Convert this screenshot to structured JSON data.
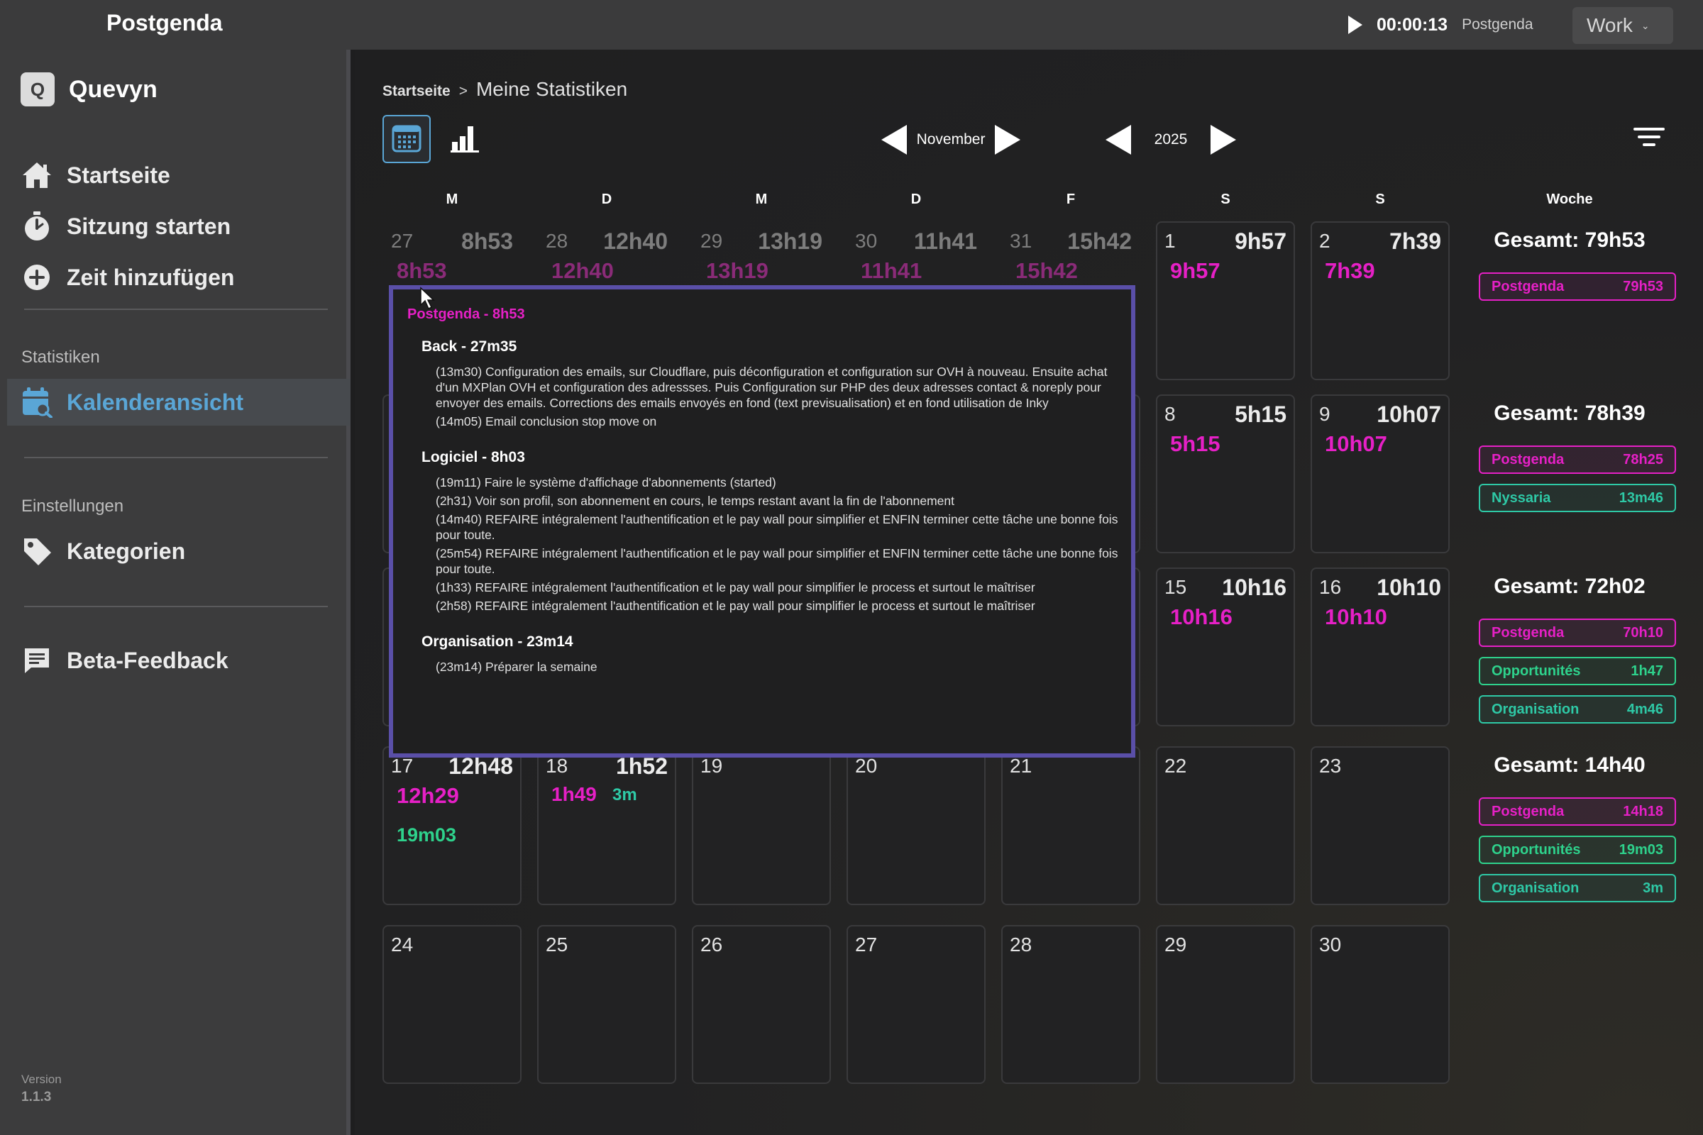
{
  "app": {
    "title": "Postgenda"
  },
  "timer": {
    "value": "00:00:13",
    "project": "Postgenda"
  },
  "workspace": {
    "label": "Work"
  },
  "sidebar": {
    "brand": {
      "logo_letter": "Q",
      "name": "Quevyn"
    },
    "nav": [
      {
        "label": "Startseite",
        "icon": "home-icon"
      },
      {
        "label": "Sitzung starten",
        "icon": "stopwatch-icon"
      },
      {
        "label": "Zeit hinzufügen",
        "icon": "plus-circle-icon"
      }
    ],
    "section_statistics": "Statistiken",
    "calendar_view": {
      "label": "Kalenderansicht",
      "icon": "calendar-search-icon"
    },
    "section_settings": "Einstellungen",
    "categories": {
      "label": "Kategorien",
      "icon": "tag-icon"
    },
    "feedback": {
      "label": "Beta-Feedback",
      "icon": "feedback-icon"
    },
    "version_label": "Version",
    "version_value": "1.1.3"
  },
  "breadcrumb": {
    "home": "Startseite",
    "separator": ">",
    "current": "Meine Statistiken"
  },
  "navigation": {
    "month": "November",
    "year": "2025"
  },
  "weekdays": [
    "M",
    "D",
    "M",
    "D",
    "F",
    "S",
    "S"
  ],
  "week_header": "Woche",
  "calendar": {
    "row1": [
      {
        "day": "27",
        "total": "8h53",
        "pg": "8h53"
      },
      {
        "day": "28",
        "total": "12h40",
        "pg": "12h40"
      },
      {
        "day": "29",
        "total": "13h19",
        "pg": "13h19"
      },
      {
        "day": "30",
        "total": "11h41",
        "pg": "11h41"
      },
      {
        "day": "31",
        "total": "15h42",
        "pg": "15h42"
      },
      {
        "day": "1",
        "total": "9h57",
        "pg": "9h57"
      },
      {
        "day": "2",
        "total": "7h39",
        "pg": "7h39"
      }
    ],
    "row2": [
      {
        "day": "8",
        "total": "5h15",
        "pg": "5h15"
      },
      {
        "day": "9",
        "total": "10h07",
        "pg": "10h07"
      }
    ],
    "row3": [
      {
        "day": "15",
        "total": "10h16",
        "pg": "10h16"
      },
      {
        "day": "16",
        "total": "10h10",
        "pg": "10h10"
      }
    ],
    "row4": [
      {
        "day": "17",
        "total": "12h48",
        "pg": "12h29",
        "green": "19m03"
      },
      {
        "day": "18",
        "total": "1h52",
        "pg": "1h49",
        "green": "3m"
      },
      {
        "day": "19"
      },
      {
        "day": "20"
      },
      {
        "day": "21"
      },
      {
        "day": "22"
      },
      {
        "day": "23"
      }
    ],
    "row5": [
      {
        "day": "24"
      },
      {
        "day": "25"
      },
      {
        "day": "26"
      },
      {
        "day": "27"
      },
      {
        "day": "28"
      },
      {
        "day": "29"
      },
      {
        "day": "30"
      }
    ]
  },
  "weeks": [
    {
      "total": "Gesamt: 79h53",
      "items": [
        {
          "name": "Postgenda",
          "value": "79h53",
          "color": "#e620c6"
        }
      ]
    },
    {
      "total": "Gesamt: 78h39",
      "items": [
        {
          "name": "Postgenda",
          "value": "78h25",
          "color": "#e620c6"
        },
        {
          "name": "Nyssaria",
          "value": "13m46",
          "color": "#2ec9a6"
        }
      ]
    },
    {
      "total": "Gesamt: 72h02",
      "items": [
        {
          "name": "Postgenda",
          "value": "70h10",
          "color": "#e620c6"
        },
        {
          "name": "Opportunités",
          "value": "1h47",
          "color": "#2ed28c"
        },
        {
          "name": "Organisation",
          "value": "4m46",
          "color": "#2ec9a6"
        }
      ]
    },
    {
      "total": "Gesamt: 14h40",
      "items": [
        {
          "name": "Postgenda",
          "value": "14h18",
          "color": "#e620c6"
        },
        {
          "name": "Opportunités",
          "value": "19m03",
          "color": "#2ed28c"
        },
        {
          "name": "Organisation",
          "value": "3m",
          "color": "#2ec9a6"
        }
      ]
    }
  ],
  "tooltip": {
    "title": "Postgenda - 8h53",
    "sections": [
      {
        "heading": "Back - 27m35",
        "lines": [
          "(13m30) Configuration des emails, sur Cloudflare, puis déconfiguration et configuration sur OVH à nouveau. Ensuite achat d'un MXPlan OVH et configuration des adressses. Puis Configuration sur PHP des deux adresses contact & noreply pour envoyer des emails. Corrections des emails envoyés en fond (text previsualisation) et en fond utilisation de Inky",
          "(14m05) Email conclusion stop move on"
        ]
      },
      {
        "heading": "Logiciel - 8h03",
        "lines": [
          "(19m11) Faire le système d'affichage d'abonnements (started)",
          "(2h31) Voir son profil, son abonnement en cours, le temps restant avant la fin de l'abonnement",
          "(14m40) REFAIRE intégralement l'authentification et le pay wall pour simplifier et ENFIN terminer cette tâche une bonne fois pour toute.",
          "(25m54) REFAIRE intégralement l'authentification et le pay wall pour simplifier et ENFIN terminer cette tâche une bonne fois pour toute.",
          "(1h33) REFAIRE intégralement l'authentification et le pay wall pour simplifier le process et surtout le maîtriser",
          "(2h58) REFAIRE intégralement l'authentification et le pay wall pour simplifier le process et surtout le maîtriser"
        ]
      },
      {
        "heading": "Organisation - 23m14",
        "lines": [
          "(23m14) Préparer la semaine"
        ]
      }
    ]
  }
}
